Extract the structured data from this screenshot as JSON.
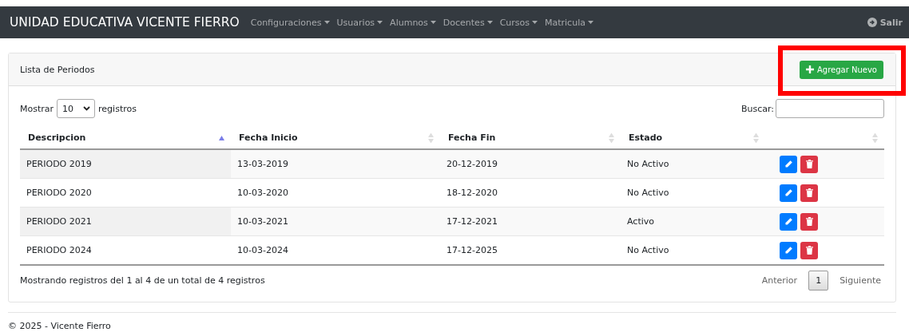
{
  "navbar": {
    "brand": "UNIDAD EDUCATIVA VICENTE FIERRO",
    "menus": [
      {
        "label": "Configuraciones"
      },
      {
        "label": "Usuarios"
      },
      {
        "label": "Alumnos"
      },
      {
        "label": "Docentes"
      },
      {
        "label": "Cursos"
      },
      {
        "label": "Matricula"
      }
    ],
    "logout": "Salir"
  },
  "card": {
    "title": "Lista de Periodos",
    "add_button": "Agregar Nuevo",
    "annotation": {
      "kind": "highlight-box"
    }
  },
  "length": {
    "before": "Mostrar",
    "value": "10",
    "after": "registros"
  },
  "search": {
    "label": "Buscar:"
  },
  "table": {
    "columns": [
      {
        "label": "Descripcion",
        "sorted": true
      },
      {
        "label": "Fecha Inicio",
        "sorted": false
      },
      {
        "label": "Fecha Fin",
        "sorted": false
      },
      {
        "label": "Estado",
        "sorted": false
      },
      {
        "sorted": false
      }
    ],
    "rows": [
      {
        "cells": [
          "PERIODO 2019",
          "13-03-2019",
          "20-12-2019",
          "No Activo"
        ]
      },
      {
        "cells": [
          "PERIODO 2020",
          "10-03-2020",
          "18-12-2020",
          "No Activo"
        ]
      },
      {
        "cells": [
          "PERIODO 2021",
          "10-03-2021",
          "17-12-2021",
          "Activo"
        ]
      },
      {
        "cells": [
          "PERIODO 2024",
          "10-03-2024",
          "17-12-2025",
          "No Activo"
        ]
      }
    ]
  },
  "info": "Mostrando registros del 1 al 4 de un total de 4 registros",
  "pagination": {
    "previous": "Anterior",
    "pages": [
      {
        "label": "1",
        "selected": true
      }
    ],
    "next": "Siguiente"
  },
  "footer": "© 2025 - Vicente Fierro"
}
